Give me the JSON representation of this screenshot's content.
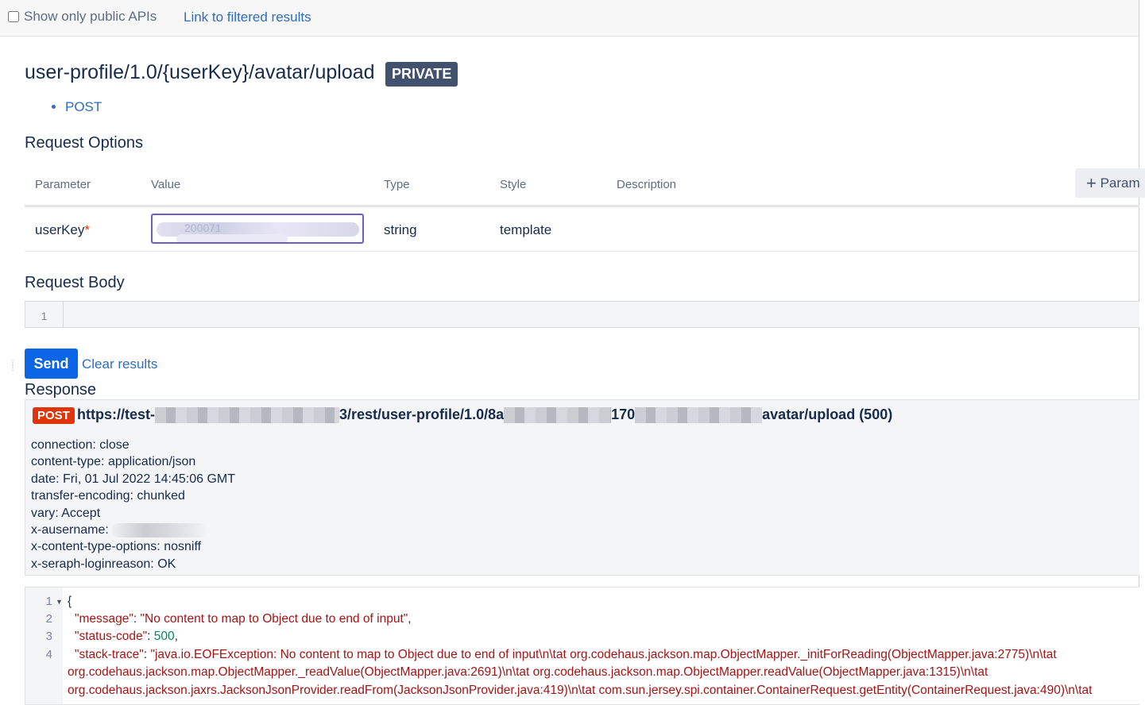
{
  "topbar": {
    "checkbox_label": "Show only public APIs",
    "link": "Link to filtered results"
  },
  "endpoint": {
    "path": "user-profile/1.0/{userKey}/avatar/upload",
    "badge": "PRIVATE",
    "methods": [
      "POST"
    ]
  },
  "request_options": {
    "heading": "Request Options",
    "columns": [
      "Parameter",
      "Value",
      "Type",
      "Style",
      "Description"
    ],
    "add_param_label": "Param",
    "rows": [
      {
        "parameter": "userKey",
        "required_mark": "*",
        "value": "200071",
        "type": "string",
        "style": "template",
        "description": ""
      }
    ]
  },
  "request_body": {
    "heading": "Request Body",
    "line_numbers": [
      "1"
    ]
  },
  "actions": {
    "send": "Send",
    "clear": "Clear results"
  },
  "response": {
    "heading": "Response",
    "method": "POST",
    "url_prefix": "https://test-",
    "url_mid": "3/rest/user-profile/1.0/8a",
    "url_mid2": "170",
    "url_suffix": "avatar/upload (500)",
    "headers": [
      "connection: close",
      "content-type: application/json",
      "date: Fri, 01 Jul 2022 14:45:06 GMT",
      "transfer-encoding: chunked",
      "vary: Accept",
      "x-ausername: ",
      "x-content-type-options: nosniff",
      "x-seraph-loginreason: OK"
    ],
    "body": {
      "line_numbers": [
        "1",
        "2",
        "3",
        "4"
      ],
      "open_brace": "{",
      "message_key": "\"message\"",
      "message_value": "\"No content to map to Object due to end of input\"",
      "status_key": "\"status-code\"",
      "status_value": "500",
      "trace_key": "\"stack-trace\"",
      "trace_line1": "\"java.io.EOFException: No content to map to Object due to end of input\\n\\tat org.codehaus.jackson.map.ObjectMapper._initForReading(ObjectMapper.java:2775)\\n\\tat",
      "trace_line2": "org.codehaus.jackson.map.ObjectMapper._readValue(ObjectMapper.java:2691)\\n\\tat org.codehaus.jackson.map.ObjectMapper.readValue(ObjectMapper.java:1315)\\n\\tat",
      "trace_line3": "org.codehaus.jackson.jaxrs.JacksonJsonProvider.readFrom(JacksonJsonProvider.java:419)\\n\\tat com.sun.jersey.spi.container.ContainerRequest.getEntity(ContainerRequest.java:490)\\n\\tat"
    }
  },
  "colors": {
    "link": "#2f6dbd",
    "primary_button": "#0a66e4",
    "private_badge": "#42526e",
    "post_badge": "#de350b",
    "json_string": "#a31515",
    "json_number": "#098658"
  }
}
